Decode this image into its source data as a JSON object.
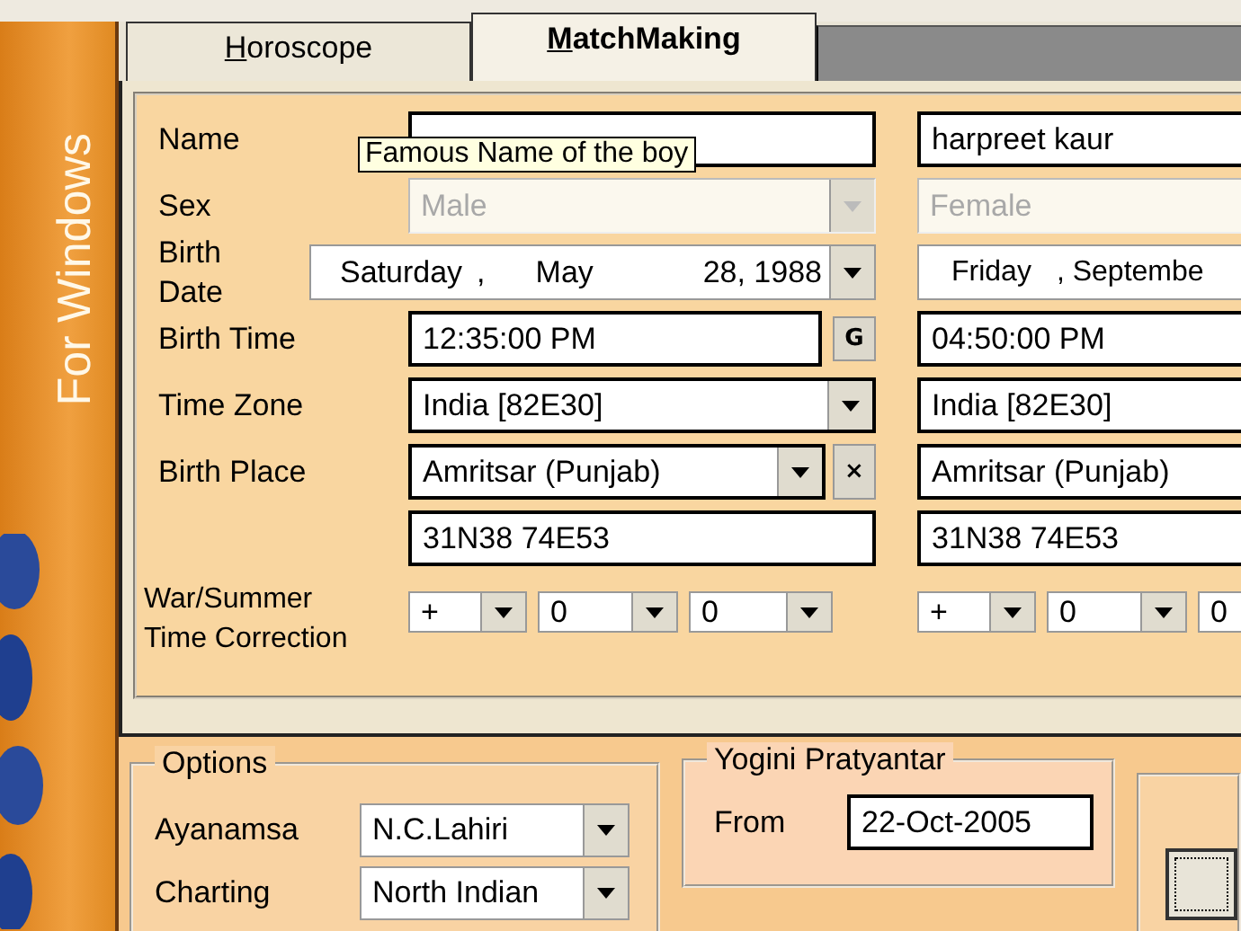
{
  "sidebar": {
    "subtitle": "For Windows"
  },
  "tabs": [
    {
      "label": "Horoscope",
      "selected": false
    },
    {
      "label": "MatchMaking",
      "selected": true
    }
  ],
  "rows": [
    {
      "kind": "text",
      "label": "Name",
      "cells": [
        {
          "tooltip": "Famous Name of the boy"
        },
        {
          "value": "harpreet kaur"
        }
      ]
    },
    {
      "kind": "combo",
      "label": "Sex",
      "cells": [
        {
          "value": "Male",
          "disabled": true
        },
        {
          "value": "Female",
          "disabled": true
        }
      ]
    },
    {
      "kind": "date",
      "label": "Birth Date",
      "cells": [
        {
          "parts": [
            "Saturday",
            ",",
            "May",
            "28, 1988"
          ]
        },
        {
          "parts": [
            "Friday",
            ", Septembe"
          ]
        }
      ]
    },
    {
      "kind": "text",
      "label": "Birth Time",
      "cells": [
        {
          "value": "12:35:00 PM",
          "button": "G"
        },
        {
          "value": "04:50:00 PM"
        }
      ]
    },
    {
      "kind": "combo",
      "label": "Time Zone",
      "cells": [
        {
          "value": "India [82E30]"
        },
        {
          "value": "India [82E30]"
        }
      ]
    },
    {
      "kind": "combo",
      "label": "Birth Place",
      "cells": [
        {
          "value": "Amritsar (Punjab)",
          "button": "×"
        },
        {
          "value": "Amritsar (Punjab)"
        }
      ]
    },
    {
      "kind": "text",
      "cells": [
        {
          "value": "31N38 74E53"
        },
        {
          "value": "31N38 74E53"
        }
      ]
    },
    {
      "kind": "correction",
      "label": "War/Summer Time Correction",
      "cells": [
        {
          "parts": [
            "+",
            "0",
            "0"
          ]
        },
        {
          "parts": [
            "+",
            "0",
            "0"
          ]
        }
      ]
    }
  ],
  "options": {
    "title": "Options",
    "rows": [
      {
        "label": "Ayanamsa",
        "value": "N.C.Lahiri"
      },
      {
        "label": "Charting",
        "value": "North Indian"
      }
    ]
  },
  "yogini": {
    "title": "Yogini Pratyantar",
    "label": "From",
    "value": "22-Oct-2005"
  }
}
